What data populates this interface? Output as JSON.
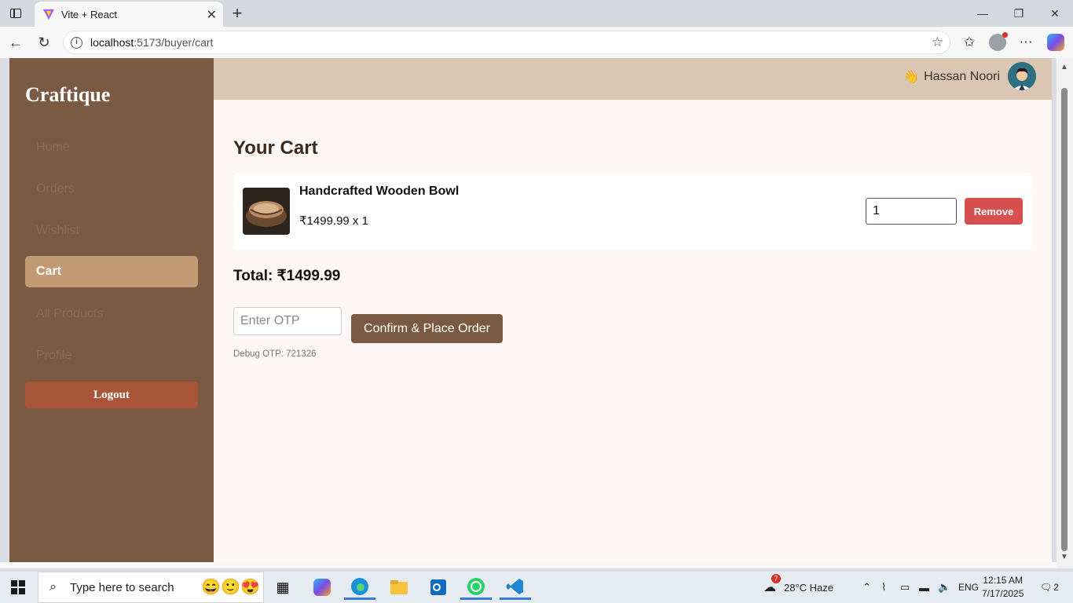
{
  "browser": {
    "tab_title": "Vite + React",
    "url_host": "localhost",
    "url_rest": ":5173/buyer/cart"
  },
  "sidebar": {
    "brand": "Craftique",
    "items": [
      {
        "label": "Home"
      },
      {
        "label": "Orders"
      },
      {
        "label": "Wishlist"
      },
      {
        "label": "Cart"
      },
      {
        "label": "All Products"
      },
      {
        "label": "Profile"
      }
    ],
    "active_item": "Cart",
    "logout_label": "Logout"
  },
  "topbar": {
    "user_name": "Hassan Noori"
  },
  "cart": {
    "heading": "Your Cart",
    "items": [
      {
        "name": "Handcrafted Wooden Bowl",
        "price_line": "₹1499.99 x 1",
        "quantity": "1",
        "remove_label": "Remove"
      }
    ],
    "total": "Total: ₹1499.99",
    "otp_placeholder": "Enter OTP",
    "confirm_label": "Confirm & Place Order",
    "debug_otp": "Debug OTP: 721326"
  },
  "taskbar": {
    "search_placeholder": "Type here to search",
    "weather_badge": "7",
    "weather": "28°C  Haze",
    "language": "ENG",
    "time": "12:15 AM",
    "date": "7/17/2025",
    "notifications": "2"
  },
  "colors": {
    "sidebar": "#7b5a43",
    "active_item": "#c29a74",
    "logout": "#a8553a",
    "remove": "#d84f4f",
    "topbar": "#dbc6b3",
    "page_bg": "#fdf8f5"
  }
}
